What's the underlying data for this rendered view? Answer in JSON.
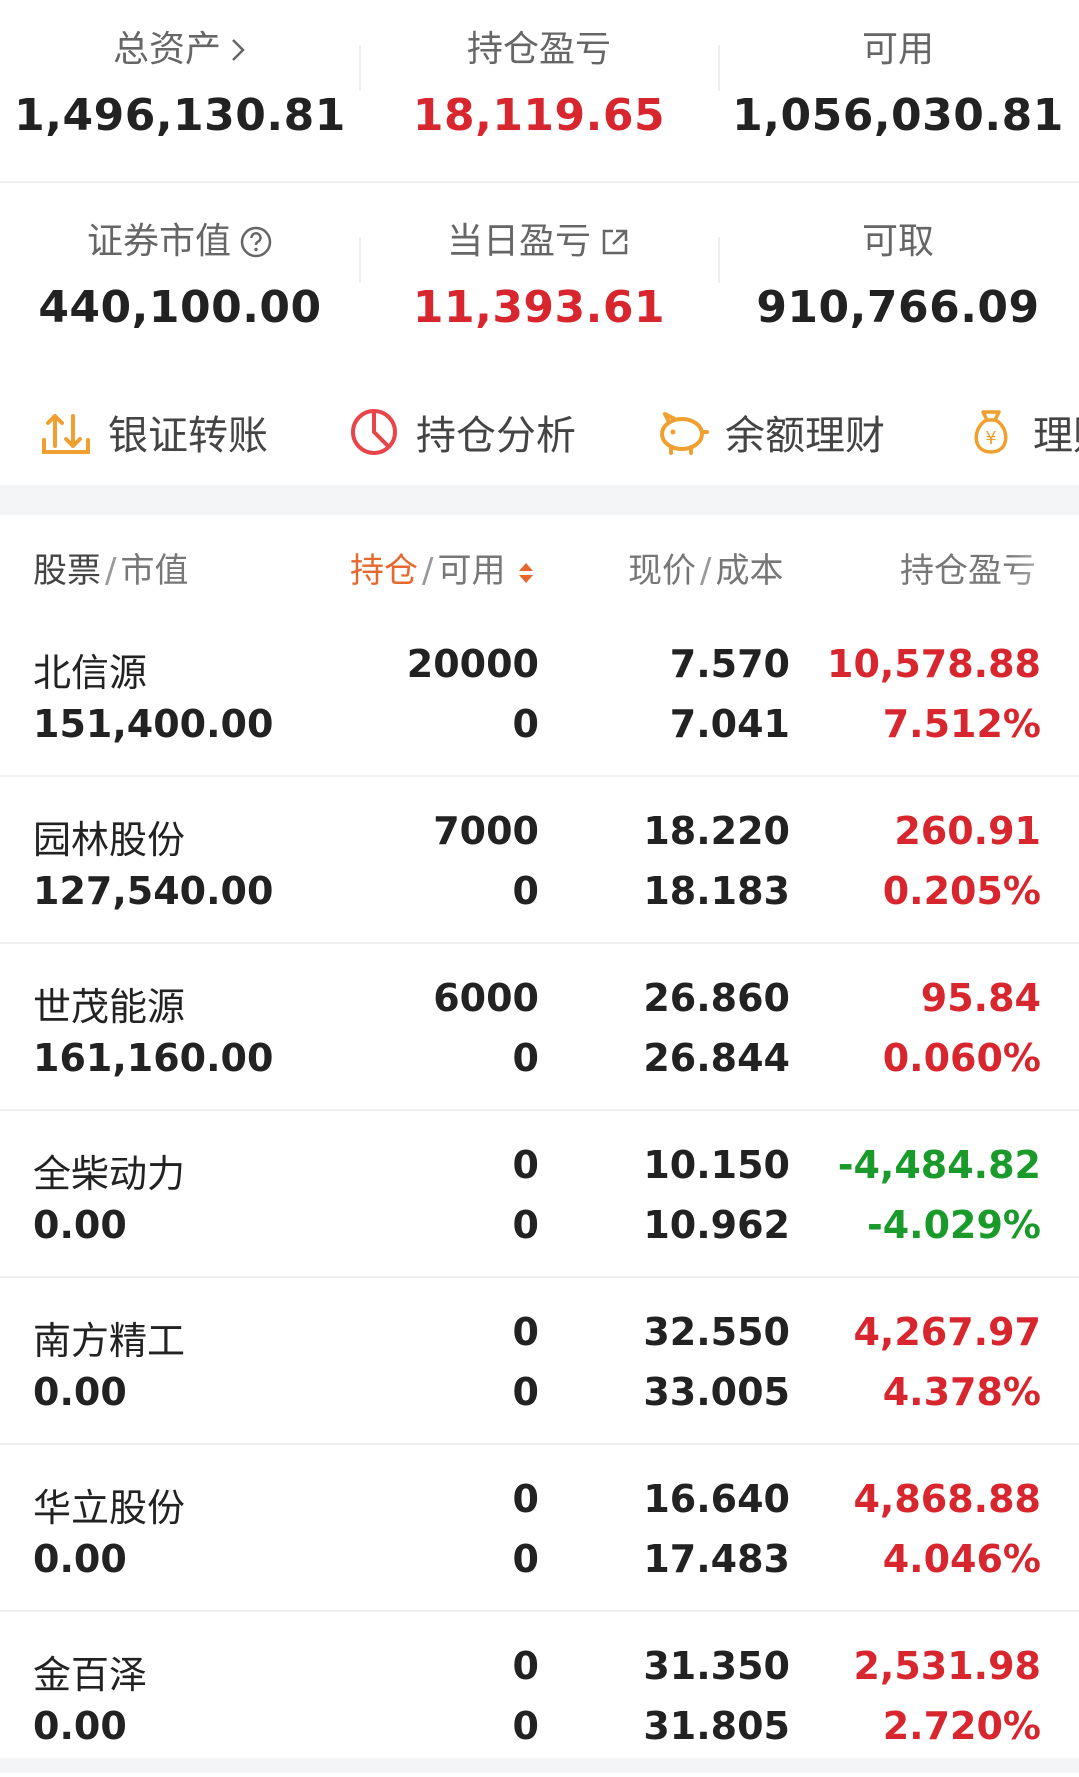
{
  "summary": {
    "total_assets_label": "总资产",
    "total_assets_value": "1,496,130.81",
    "position_pl_label": "持仓盈亏",
    "position_pl_value": "18,119.65",
    "available_label": "可用",
    "available_value": "1,056,030.81",
    "securities_value_label": "证券市值",
    "securities_value_value": "440,100.00",
    "daily_pl_label": "当日盈亏",
    "daily_pl_value": "11,393.61",
    "withdrawable_label": "可取",
    "withdrawable_value": "910,766.09"
  },
  "actions": [
    {
      "label": "银证转账",
      "icon": "transfer-icon"
    },
    {
      "label": "持仓分析",
      "icon": "pie-chart-icon"
    },
    {
      "label": "余额理财",
      "icon": "piggy-bank-icon"
    },
    {
      "label": "理财",
      "icon": "money-bag-icon"
    }
  ],
  "table": {
    "headers": {
      "stock": "股票",
      "market_value": "市值",
      "position": "持仓",
      "available": "可用",
      "price": "现价",
      "cost": "成本",
      "pl": "持仓盈亏"
    },
    "rows": [
      {
        "name": "北信源",
        "market_value": "151,400.00",
        "position": "20000",
        "available": "0",
        "price": "7.570",
        "cost": "7.041",
        "pl": "10,578.88",
        "pl_pct": "7.512%",
        "trend": "up"
      },
      {
        "name": "园林股份",
        "market_value": "127,540.00",
        "position": "7000",
        "available": "0",
        "price": "18.220",
        "cost": "18.183",
        "pl": "260.91",
        "pl_pct": "0.205%",
        "trend": "up"
      },
      {
        "name": "世茂能源",
        "market_value": "161,160.00",
        "position": "6000",
        "available": "0",
        "price": "26.860",
        "cost": "26.844",
        "pl": "95.84",
        "pl_pct": "0.060%",
        "trend": "up"
      },
      {
        "name": "全柴动力",
        "market_value": "0.00",
        "position": "0",
        "available": "0",
        "price": "10.150",
        "cost": "10.962",
        "pl": "-4,484.82",
        "pl_pct": "-4.029%",
        "trend": "down"
      },
      {
        "name": "南方精工",
        "market_value": "0.00",
        "position": "0",
        "available": "0",
        "price": "32.550",
        "cost": "33.005",
        "pl": "4,267.97",
        "pl_pct": "4.378%",
        "trend": "up"
      },
      {
        "name": "华立股份",
        "market_value": "0.00",
        "position": "0",
        "available": "0",
        "price": "16.640",
        "cost": "17.483",
        "pl": "4,868.88",
        "pl_pct": "4.046%",
        "trend": "up"
      },
      {
        "name": "金百泽",
        "market_value": "0.00",
        "position": "0",
        "available": "0",
        "price": "31.350",
        "cost": "31.805",
        "pl": "2,531.98",
        "pl_pct": "2.720%",
        "trend": "up"
      }
    ]
  },
  "colors": {
    "up": "#d8262e",
    "down": "#1a9a2a",
    "accent": "#e5692e",
    "icon_orange": "#f0a030",
    "icon_red": "#e8454a"
  }
}
